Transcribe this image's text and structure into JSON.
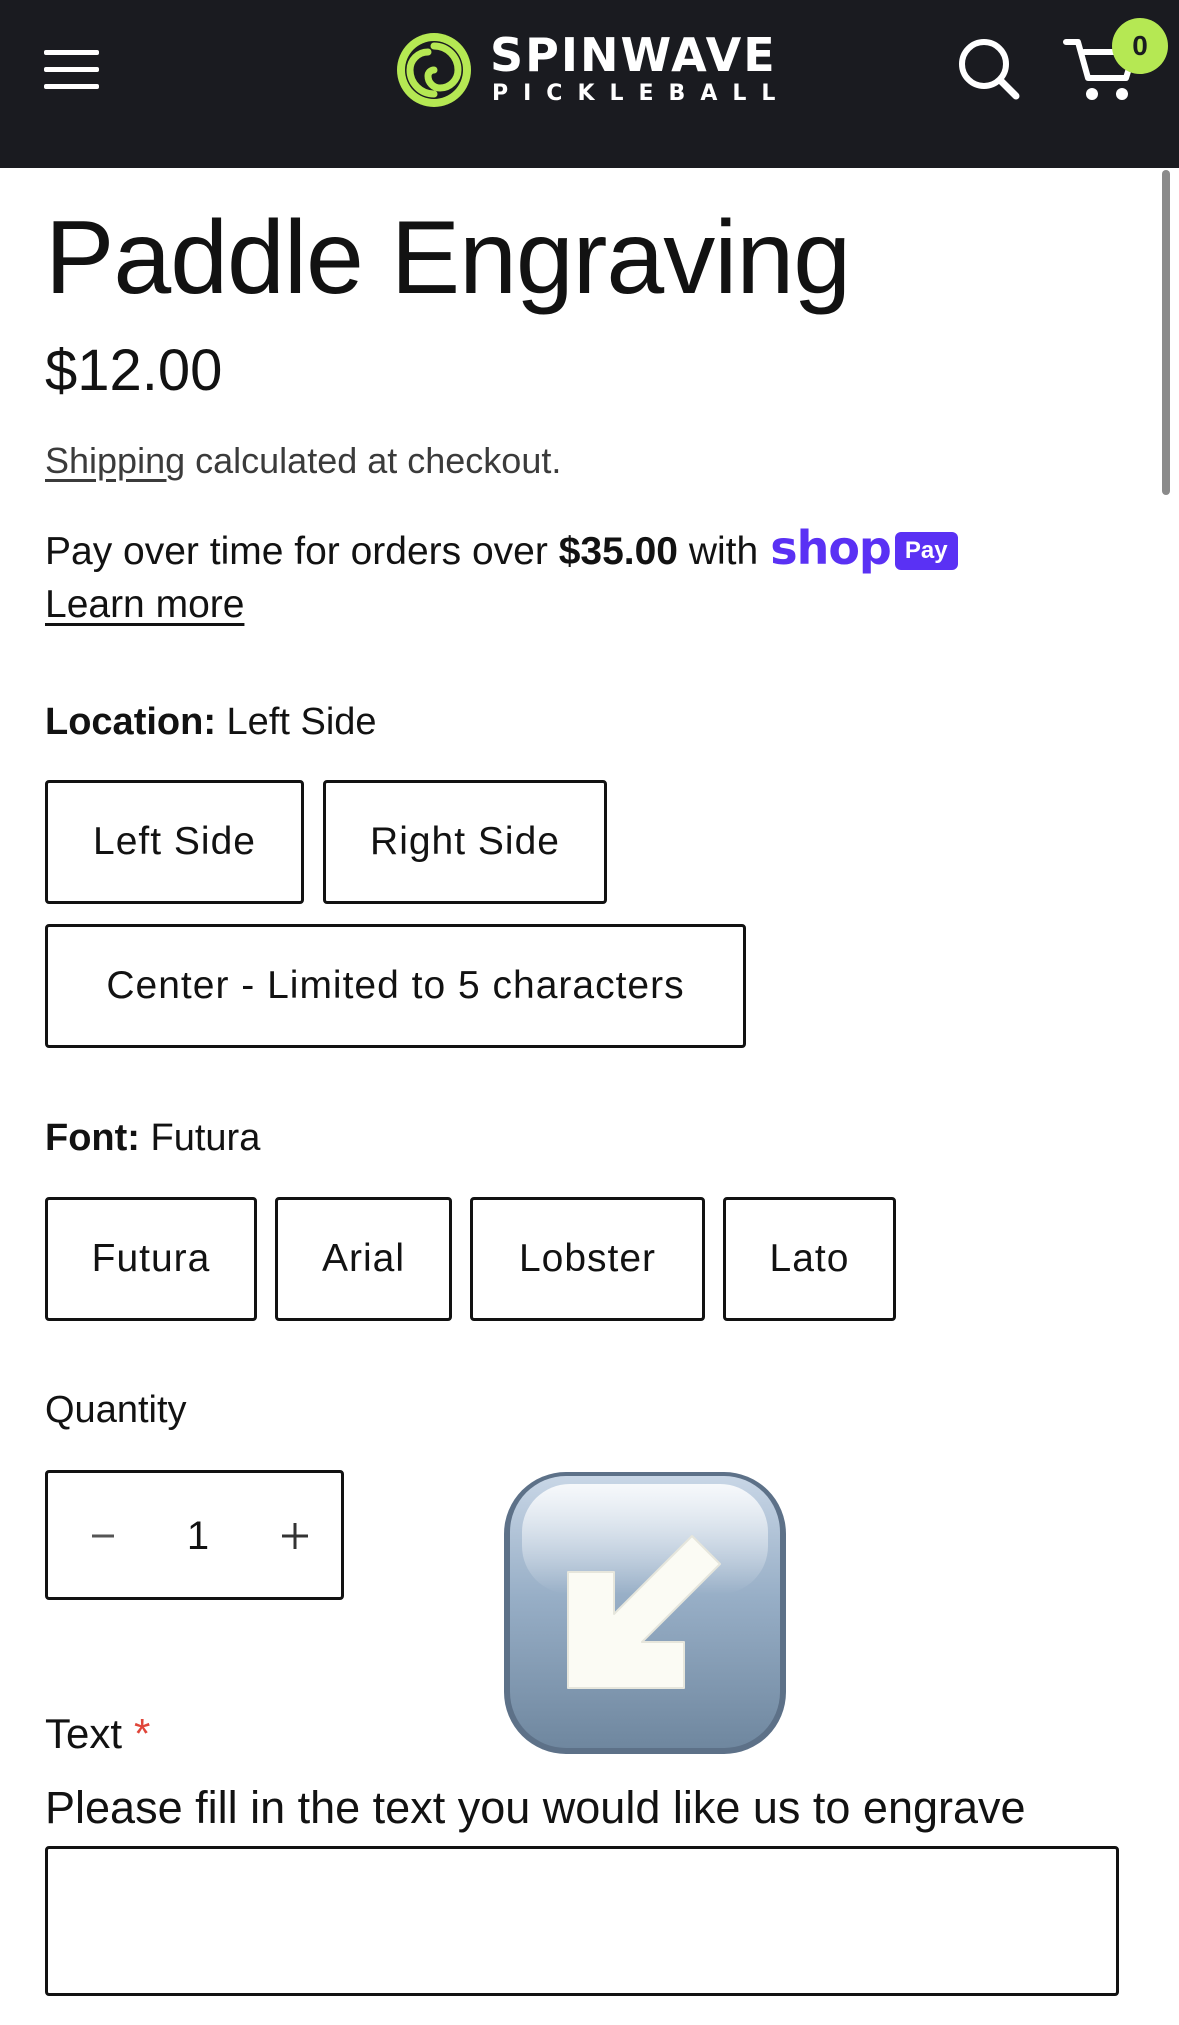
{
  "header": {
    "brand_name": "SPINWAVE",
    "brand_sub": "PICKLEBALL",
    "cart_count": "0",
    "accent_color": "#b5e853",
    "background_color": "#1a1b20",
    "icons": [
      "menu-icon",
      "logo-swirl-icon",
      "search-icon",
      "cart-icon"
    ]
  },
  "product": {
    "title": "Paddle Engraving",
    "price": "$12.00",
    "shipping_link": "Shipping",
    "shipping_rest": " calculated at checkout.",
    "pay_text_pre": "Pay over time for orders over ",
    "pay_amount": "$35.00",
    "pay_text_post": " with",
    "shop_word": "shop",
    "pay_badge": "Pay",
    "learn_more": "Learn more",
    "shop_pay_color": "#5a31f4"
  },
  "location": {
    "label": "Location:",
    "selected": "Left Side",
    "options": [
      "Left Side",
      "Right Side",
      "Center - Limited to 5 characters"
    ]
  },
  "font": {
    "label": "Font:",
    "selected": "Futura",
    "options": [
      "Futura",
      "Arial",
      "Lobster",
      "Lato"
    ]
  },
  "quantity": {
    "label": "Quantity",
    "value": "1"
  },
  "overlay": {
    "icon": "down-left-arrow-emoji-icon"
  },
  "engraving": {
    "label": "Text",
    "required_mark": "*",
    "help": "Please fill in the text you would like us to engrave",
    "value": ""
  }
}
